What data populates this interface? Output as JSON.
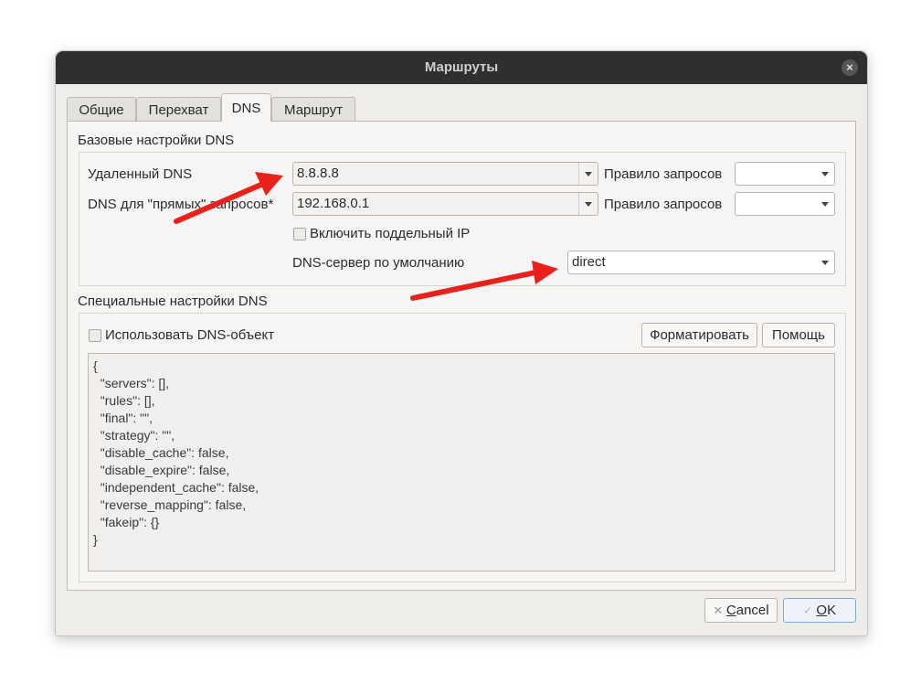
{
  "window": {
    "title": "Маршруты"
  },
  "tabs": [
    {
      "label": "Общие"
    },
    {
      "label": "Перехват"
    },
    {
      "label": "DNS"
    },
    {
      "label": "Маршрут"
    }
  ],
  "base_group": {
    "title": "Базовые настройки DNS",
    "remote_dns_label": "Удаленный DNS",
    "remote_dns_value": "8.8.8.8",
    "direct_dns_label": "DNS для \"прямых\" запросов*",
    "direct_dns_value": "192.168.0.1",
    "query_rule_label_1": "Правило запросов",
    "query_rule_value_1": "",
    "query_rule_label_2": "Правило запросов",
    "query_rule_value_2": "",
    "fake_ip_label": "Включить поддельный IP",
    "fake_ip_checked": false,
    "default_dns_label": "DNS-сервер по умолчанию",
    "default_dns_value": "direct"
  },
  "special_group": {
    "title": "Специальные настройки DNS",
    "use_object_label": "Использовать DNS-объект",
    "use_object_checked": false,
    "format_button": "Форматировать",
    "help_button": "Помощь",
    "json_lines": [
      "{",
      "  \"servers\": [],",
      "  \"rules\": [],",
      "  \"final\": \"\",",
      "  \"strategy\": \"\",",
      "  \"disable_cache\": false,",
      "  \"disable_expire\": false,",
      "  \"independent_cache\": false,",
      "  \"reverse_mapping\": false,",
      "  \"fakeip\": {}",
      "}"
    ]
  },
  "footer": {
    "cancel_first": "C",
    "cancel_rest": "ancel",
    "ok_first": "O",
    "ok_rest": "K"
  },
  "colors": {
    "annotation_arrow": "#e8211c",
    "title_bar": "#2f2f2f",
    "ok_border": "#7fa7d8"
  }
}
